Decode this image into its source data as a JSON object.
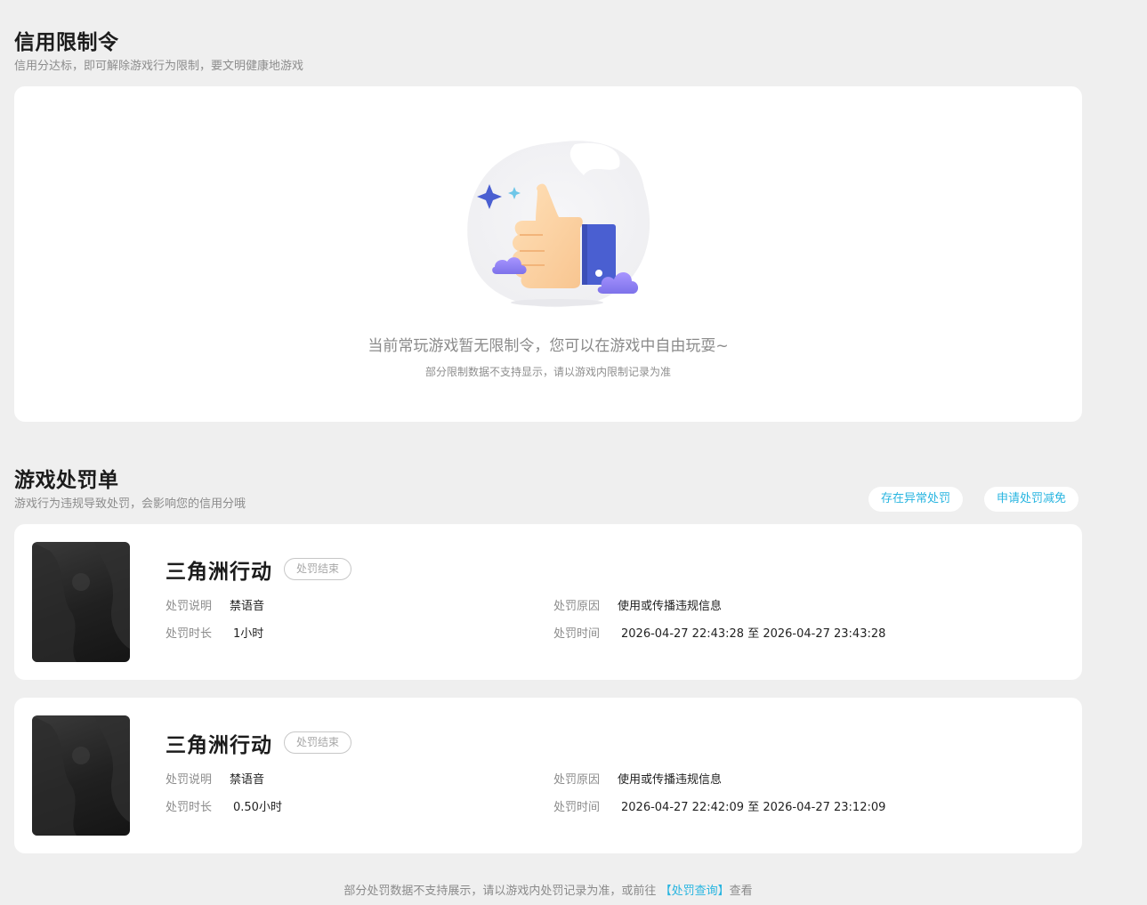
{
  "restriction": {
    "title": "信用限制令",
    "subtitle": "信用分达标，即可解除游戏行为限制，要文明健康地游戏",
    "empty_main": "当前常玩游戏暂无限制令，您可以在游戏中自由玩耍~",
    "empty_sub": "部分限制数据不支持显示，请以游戏内限制记录为准",
    "illustration": "thumbs-up-illustration"
  },
  "penalty": {
    "title": "游戏处罚单",
    "subtitle": "游戏行为违规导致处罚，会影响您的信用分哦",
    "abnormal_button": "存在异常处罚",
    "reduce_button": "申请处罚减免",
    "labels": {
      "desc": "处罚说明",
      "reason": "处罚原因",
      "duration": "处罚时长",
      "time": "处罚时间"
    },
    "items": [
      {
        "game": "三角洲行动",
        "status": "处罚结束",
        "desc": "禁语音",
        "reason": "使用或传播违规信息",
        "duration": "1小时",
        "time": "2026-04-27 22:43:28 至 2026-04-27 23:43:28"
      },
      {
        "game": "三角洲行动",
        "status": "处罚结束",
        "desc": "禁语音",
        "reason": "使用或传播违规信息",
        "duration": "0.50小时",
        "time": "2026-04-27 22:42:09 至 2026-04-27 23:12:09"
      }
    ]
  },
  "footer": {
    "prefix": "部分处罚数据不支持展示，请以游戏内处罚记录为准，或前往",
    "link": "【处罚查询】",
    "suffix": "查看"
  },
  "colors": {
    "accent": "#28b5e0",
    "background": "#efefef",
    "card": "#ffffff",
    "thumb_blue": "#4a5fd1",
    "cloud_purple": "#8a7cf0"
  }
}
